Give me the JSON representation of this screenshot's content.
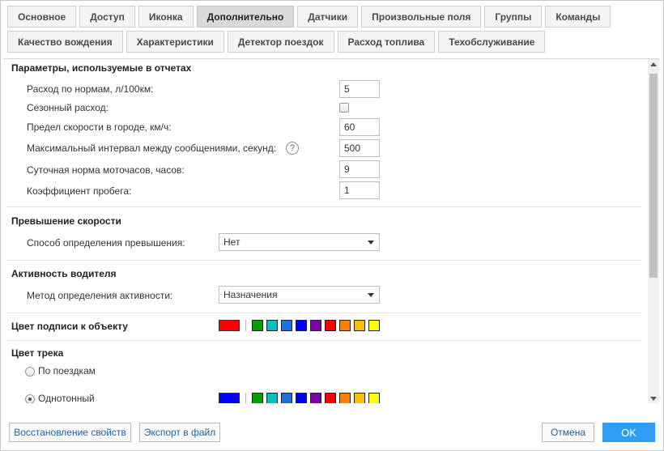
{
  "tabs_row1": [
    "Основное",
    "Доступ",
    "Иконка",
    "Дополнительно",
    "Датчики",
    "Произвольные поля",
    "Группы",
    "Команды"
  ],
  "tabs_row2": [
    "Качество вождения",
    "Характеристики",
    "Детектор поездок",
    "Расход топлива",
    "Техобслуживание"
  ],
  "active_tab": "Дополнительно",
  "report_params": {
    "title": "Параметры, используемые в отчетах",
    "norm_consumption_label": "Расход по нормам, л/100км:",
    "norm_consumption_value": "5",
    "seasonal_label": "Сезонный расход:",
    "seasonal_checked": false,
    "city_speed_label": "Предел скорости в городе, км/ч:",
    "city_speed_value": "60",
    "max_interval_label": "Максимальный интервал между сообщениями, секунд:",
    "max_interval_value": "500",
    "help_glyph": "?",
    "engine_hours_label": "Суточная норма моточасов, часов:",
    "engine_hours_value": "9",
    "mileage_coef_label": "Коэффициент пробега:",
    "mileage_coef_value": "1"
  },
  "speeding": {
    "title": "Превышение скорости",
    "method_label": "Способ определения превышения:",
    "method_value": "Нет"
  },
  "driver_activity": {
    "title": "Активность водителя",
    "method_label": "Метод определения активности:",
    "method_value": "Назначения"
  },
  "label_color": {
    "title": "Цвет подписи к объекту",
    "current": "#ff0000"
  },
  "track_color": {
    "title": "Цвет трека",
    "by_trips_label": "По поездкам",
    "by_trips_selected": false,
    "mono_label": "Однотонный",
    "mono_selected": true,
    "current": "#0000ff"
  },
  "palette": [
    "#00a000",
    "#00c0c0",
    "#1e6fd9",
    "#0000ff",
    "#7a00a8",
    "#ff0000",
    "#ff7f00",
    "#ffbf00",
    "#ffff00"
  ],
  "footer": {
    "restore_label": "Восстановление свойств",
    "export_label": "Экспорт в файл",
    "cancel_label": "Отмена",
    "ok_label": "OK"
  }
}
